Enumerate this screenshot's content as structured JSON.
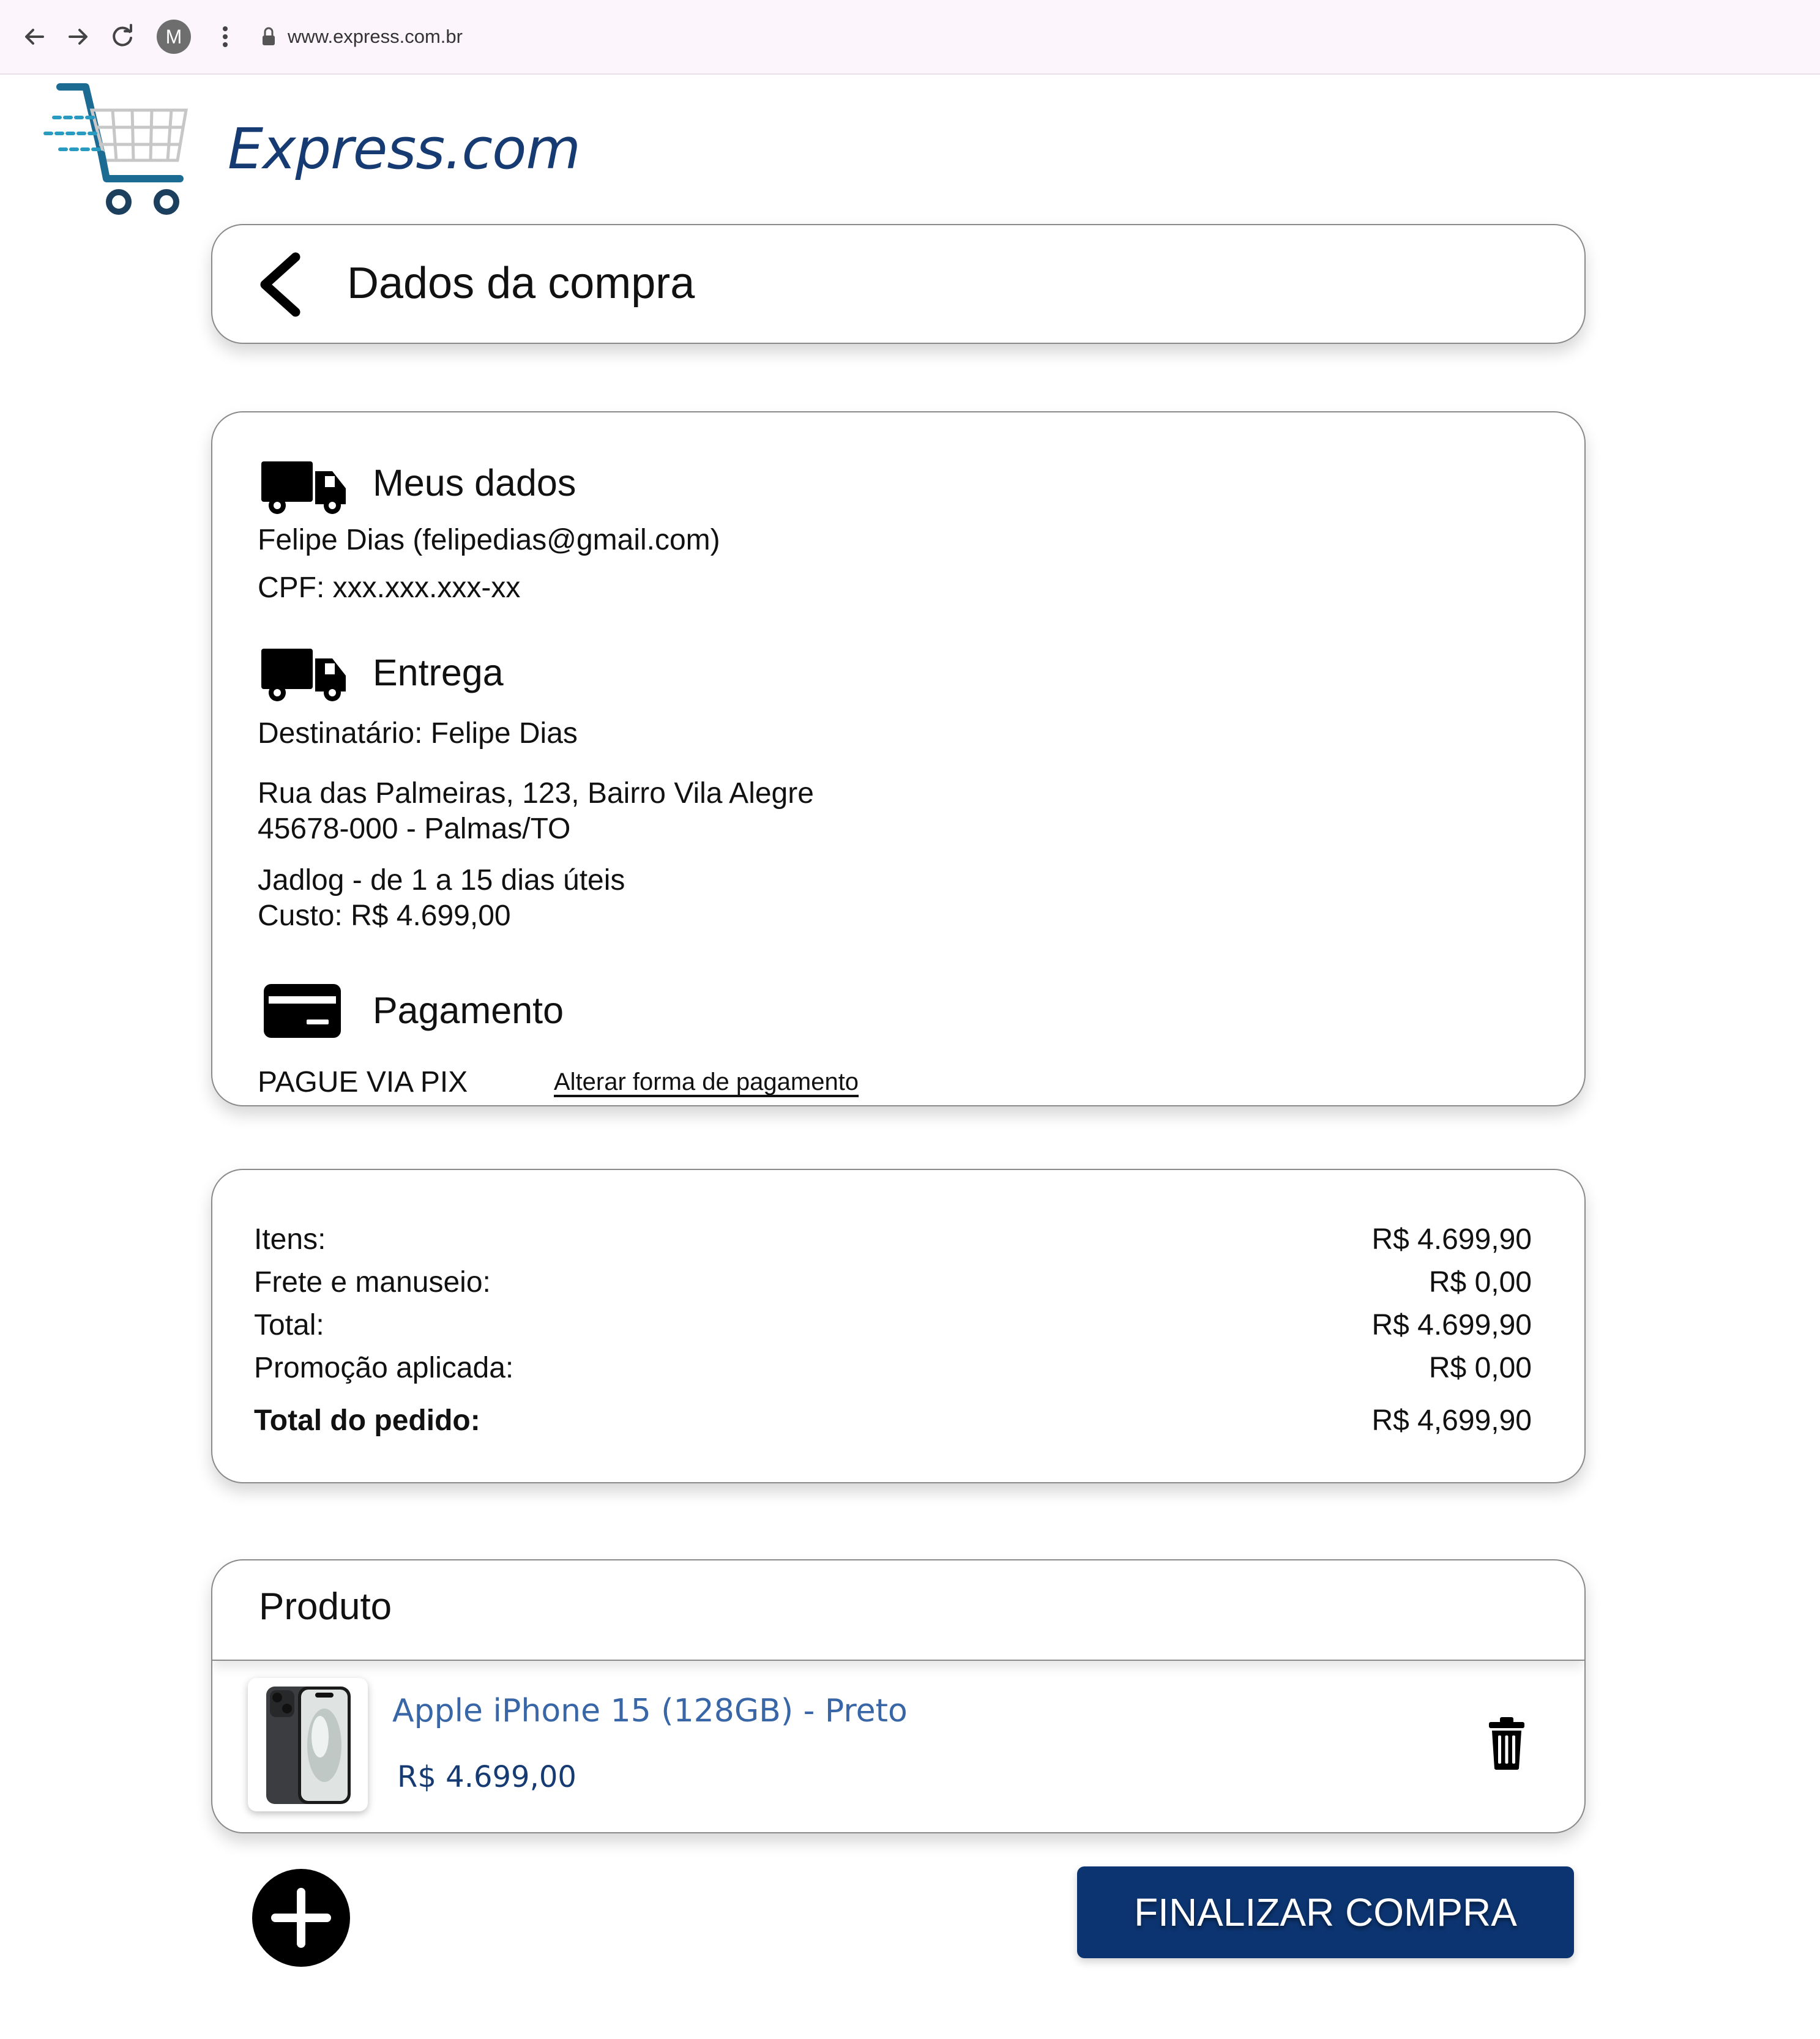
{
  "browser": {
    "avatar_letter": "M",
    "url": "www.express.com.br",
    "icons": [
      "back-arrow-icon",
      "forward-arrow-icon",
      "reload-icon",
      "menu-dots-icon",
      "lock-icon"
    ]
  },
  "brand": {
    "name": "Express.com",
    "logo": "shopping-cart-icon",
    "color": "#163a72",
    "accent": "#2a9bc0"
  },
  "header": {
    "title": "Dados da compra",
    "back_icon": "chevron-left-icon"
  },
  "my_data": {
    "title": "Meus dados",
    "icon": "truck-icon",
    "name_line": "Felipe Dias (felipedias@gmail.com)",
    "cpf_line": "CPF: xxx.xxx.xxx-xx"
  },
  "delivery": {
    "title": "Entrega",
    "icon": "truck-icon",
    "recipient": "Destinatário: Felipe Dias",
    "address_line1": "Rua das Palmeiras, 123, Bairro Vila Alegre",
    "address_line2": "45678-000 - Palmas/TO",
    "shipping_line": "Jadlog - de 1 a 15 dias úteis",
    "cost_line": "Custo: R$ 4.699,00"
  },
  "payment": {
    "title": "Pagamento",
    "icon": "credit-card-icon",
    "method": "PAGUE VIA PIX",
    "change_link": "Alterar forma de pagamento"
  },
  "summary": {
    "rows": [
      {
        "label": "Itens:",
        "value": "R$ 4.699,90"
      },
      {
        "label": "Frete e manuseio:",
        "value": "R$ 0,00"
      },
      {
        "label": "Total:",
        "value": "R$ 4.699,90"
      },
      {
        "label": "Promoção aplicada:",
        "value": "R$ 0,00"
      }
    ],
    "total_label": "Total do pedido:",
    "total_value": "R$ 4,699,90"
  },
  "product": {
    "section_title": "Produto",
    "name": "Apple iPhone 15 (128GB) - Preto",
    "price": "R$ 4.699,00",
    "image": "iphone-image",
    "delete_icon": "trash-icon"
  },
  "actions": {
    "add_icon": "plus-icon",
    "finish_label": "FINALIZAR COMPRA",
    "finish_color": "#0c3470"
  }
}
